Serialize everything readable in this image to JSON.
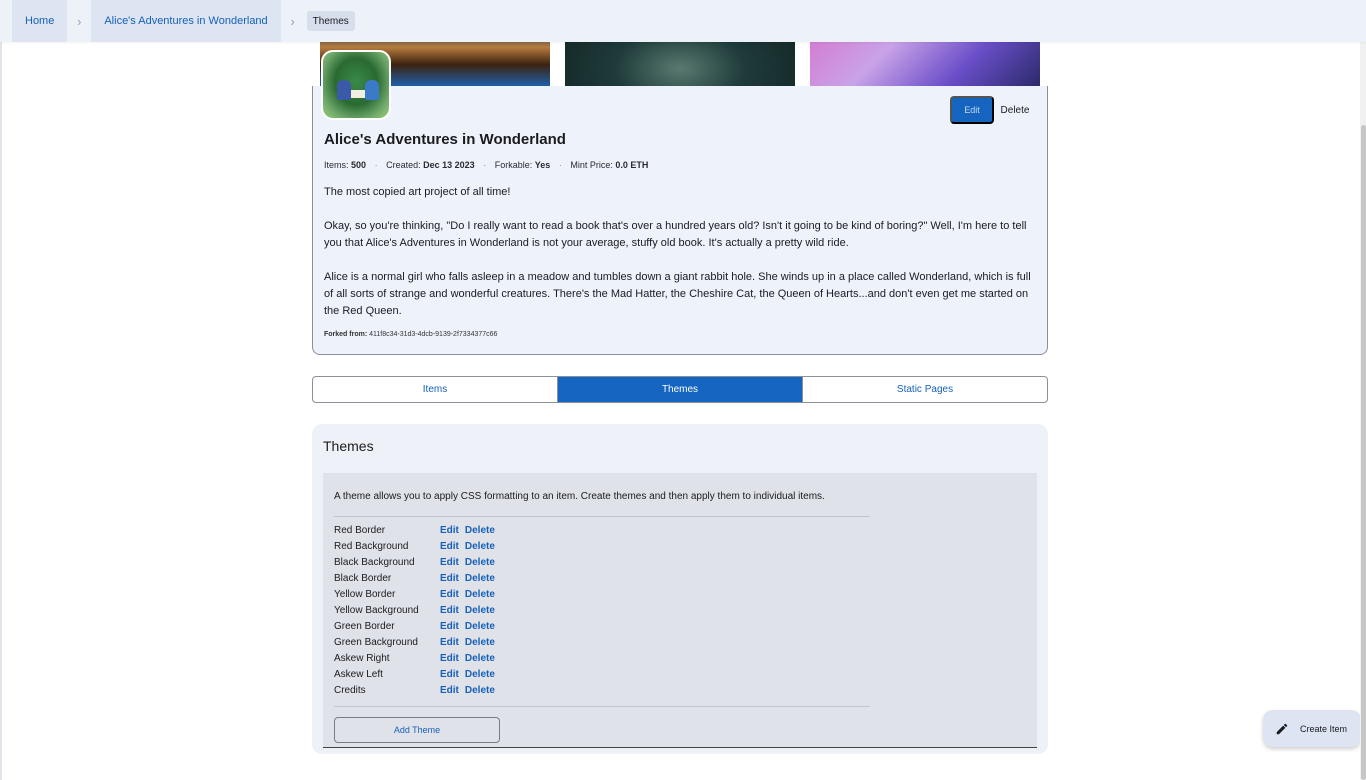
{
  "breadcrumb": {
    "home": "Home",
    "project": "Alice's Adventures in Wonderland",
    "current": "Themes"
  },
  "project": {
    "title": "Alice's Adventures in Wonderland",
    "edit_label": "Edit",
    "delete_label": "Delete",
    "meta": {
      "items_label": "Items:",
      "items_value": "500",
      "created_label": "Created:",
      "created_value": "Dec 13 2023",
      "forkable_label": "Forkable:",
      "forkable_value": "Yes",
      "mint_label": "Mint Price:",
      "mint_value": "0.0 ETH"
    },
    "description": [
      "The most copied art project of all time!",
      "Okay, so you're thinking, \"Do I really want to read a book that's over a hundred years old? Isn't it going to be kind of boring?\" Well, I'm here to tell you that Alice's Adventures in Wonderland is not your average, stuffy old book. It's actually a pretty wild ride.",
      "Alice is a normal girl who falls asleep in a meadow and tumbles down a giant rabbit hole. She winds up in a place called Wonderland, which is full of all sorts of strange and wonderful creatures. There's the Mad Hatter, the Cheshire Cat, the Queen of Hearts...and don't even get me started on the Red Queen."
    ],
    "forked_label": "Forked from:",
    "forked_value": "411f8c34-31d3-4dcb-9139-2f7334377c66"
  },
  "tabs": [
    {
      "label": "Items",
      "active": false
    },
    {
      "label": "Themes",
      "active": true
    },
    {
      "label": "Static Pages",
      "active": false
    }
  ],
  "themes": {
    "heading": "Themes",
    "intro": "A theme allows you to apply CSS formatting to an item. Create themes and then apply them to individual items.",
    "edit_label": "Edit",
    "delete_label": "Delete",
    "list": [
      "Red Border",
      "Red Background",
      "Black Background",
      "Black Border",
      "Yellow Border",
      "Yellow Background",
      "Green Border",
      "Green Background",
      "Askew Right",
      "Askew Left",
      "Credits"
    ],
    "add_label": "Add Theme"
  },
  "fab": {
    "label": "Create Item",
    "icon": "pencil-icon"
  },
  "colors": {
    "accent": "#1565c0",
    "link": "#1660b8",
    "panel": "#eef1f8"
  }
}
